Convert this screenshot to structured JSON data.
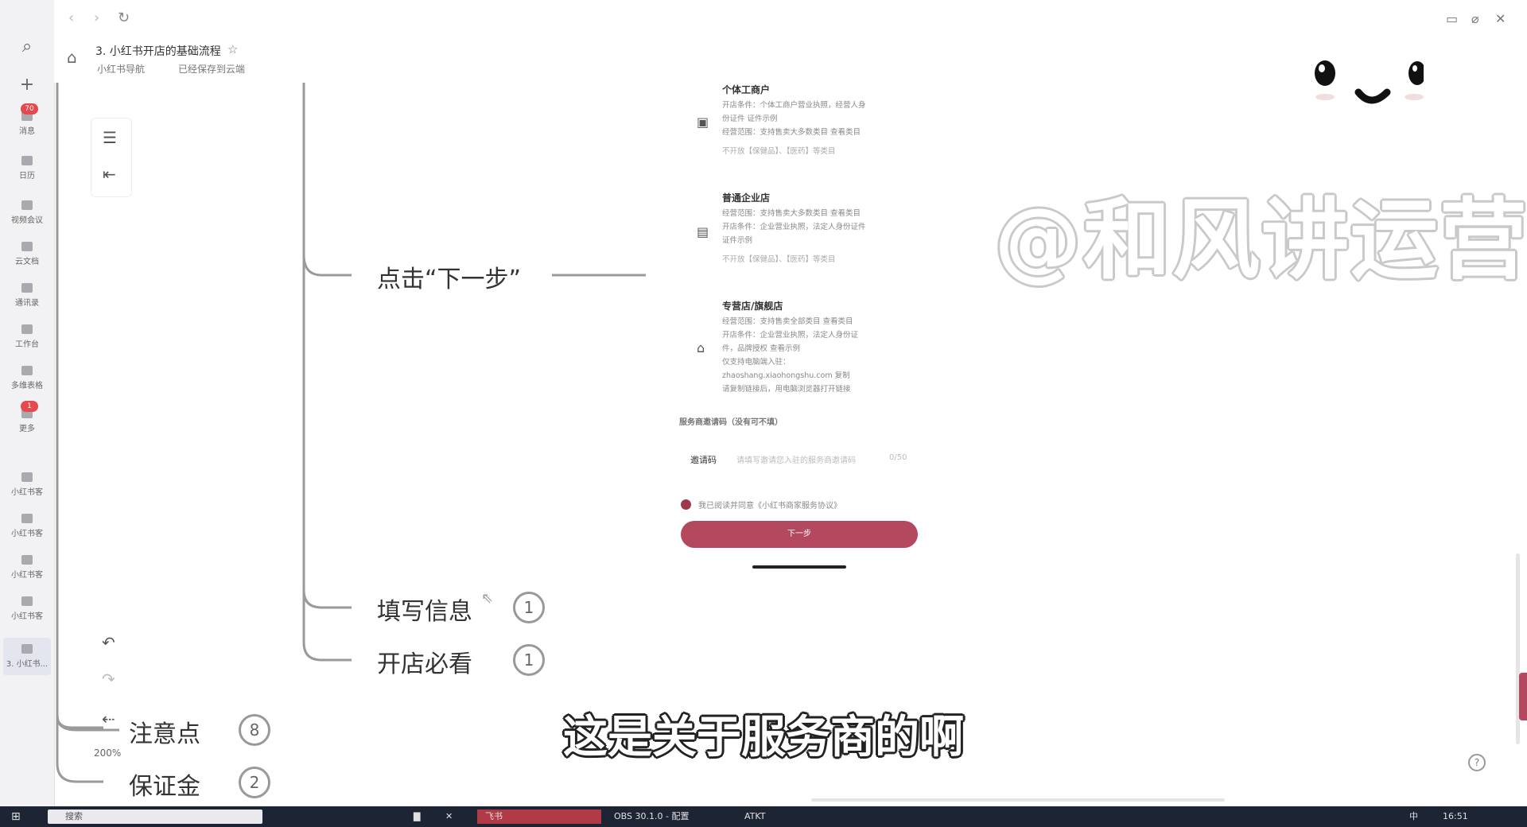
{
  "rail": {
    "top_buttons": [
      {
        "name": "search-icon",
        "glyph": "⌕"
      },
      {
        "name": "plus-icon",
        "glyph": "+"
      }
    ],
    "items": [
      {
        "label": "消息",
        "badge": "70"
      },
      {
        "label": "日历",
        "badge": ""
      },
      {
        "label": "视频会议",
        "badge": ""
      },
      {
        "label": "云文档",
        "badge": ""
      },
      {
        "label": "通讯录",
        "badge": ""
      },
      {
        "label": "工作台",
        "badge": ""
      },
      {
        "label": "多维表格",
        "badge": ""
      },
      {
        "label": "更多",
        "badge": "1"
      },
      {
        "label": "小红书客",
        "badge": ""
      },
      {
        "label": "小红书客",
        "badge": ""
      },
      {
        "label": "小红书客",
        "badge": ""
      },
      {
        "label": "小红书客",
        "badge": ""
      },
      {
        "label": "3. 小红书...",
        "badge": ""
      }
    ]
  },
  "header": {
    "title": "3. 小红书开店的基础流程",
    "owner": "小红书导航",
    "save_status": "已经保存到云端"
  },
  "mindmap": {
    "branches": [
      {
        "label": "点击“下一步”",
        "count": ""
      },
      {
        "label": "填写信息",
        "count": "1"
      },
      {
        "label": "开店必看",
        "count": "1"
      },
      {
        "label": "注意点",
        "count": "8"
      },
      {
        "label": "保证金",
        "count": "2"
      }
    ],
    "zoom": "200%"
  },
  "phone": {
    "options": [
      {
        "title": "个体工商户",
        "lines": [
          "开店条件：个体工商户营业执照，经营人身",
          "份证件 证件示例",
          "经营范围：支持售卖大多数类目 查看类目"
        ],
        "warning": "不开放【保健品】、【医药】等类目"
      },
      {
        "title": "普通企业店",
        "lines": [
          "经营范围：支持售卖大多数类目 查看类目",
          "开店条件：企业营业执照，法定人身份证件",
          "证件示例"
        ],
        "warning": "不开放【保健品】、【医药】等类目"
      },
      {
        "title": "专营店/旗舰店",
        "lines": [
          "经营范围：支持售卖全部类目 查看类目",
          "开店条件：企业营业执照，法定人身份证",
          "件，品牌授权 查看示例",
          "仅支持电脑端入驻：",
          "zhaoshang.xiaohongshu.com 复制",
          "请复制链接后，用电脑浏览器打开链接"
        ],
        "warning": ""
      }
    ],
    "invite_title": "服务商邀请码（没有可不填）",
    "invite_label": "邀请码",
    "invite_placeholder": "请填写邀请您入驻的服务商邀请码",
    "invite_count": "0/50",
    "agreement": "我已阅读并同意《小红书商家服务协议》",
    "submit_label": "下一步"
  },
  "watermark": "@和风讲运营",
  "subtitle": "这是关于服务商的啊",
  "taskbar": {
    "search_placeholder": "搜索",
    "active_app": "飞书",
    "obs_label": "OBS 30.1.0 - 配置",
    "app2_label": "ATKT",
    "ime": "中",
    "time": "16:51"
  },
  "colors": {
    "accent": "#b4485e",
    "badge": "#e5484d",
    "taskbar": "#1d2535",
    "branch_line": "#9a9a9a"
  }
}
